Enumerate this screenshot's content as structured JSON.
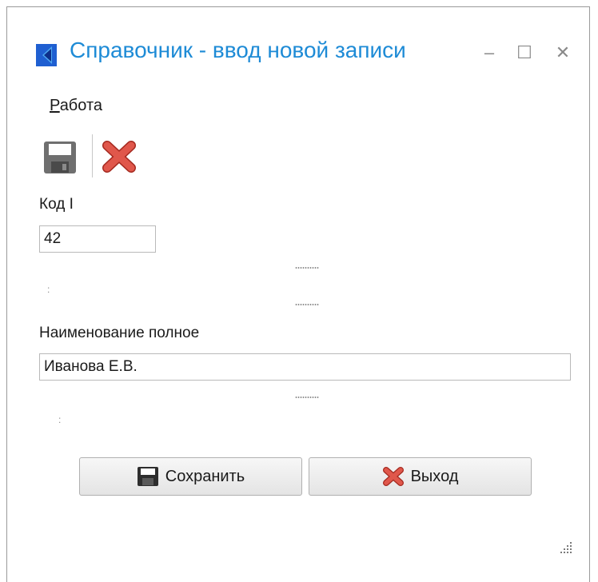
{
  "window": {
    "title": "Справочник - ввод новой записи",
    "app_icon": "directory-app-icon",
    "controls": {
      "minimize": "–",
      "maximize": "☐",
      "close": "✕"
    }
  },
  "menu": {
    "items": [
      {
        "accel": "Р",
        "rest": "абота"
      }
    ]
  },
  "toolbar": {
    "save_icon": "floppy-disk-icon",
    "delete_icon": "red-x-icon"
  },
  "form": {
    "code_label": "Код I",
    "code_value": "42",
    "name_label": "Наименование полное",
    "name_value": "Иванова Е.В.",
    "colon_1": ":",
    "colon_2": ":"
  },
  "buttons": {
    "save_label": "Сохранить",
    "exit_label": "Выход"
  },
  "colors": {
    "title": "#1e8bd6",
    "delete_icon": "#d9453a",
    "save_icon": "#6f6f6f"
  }
}
